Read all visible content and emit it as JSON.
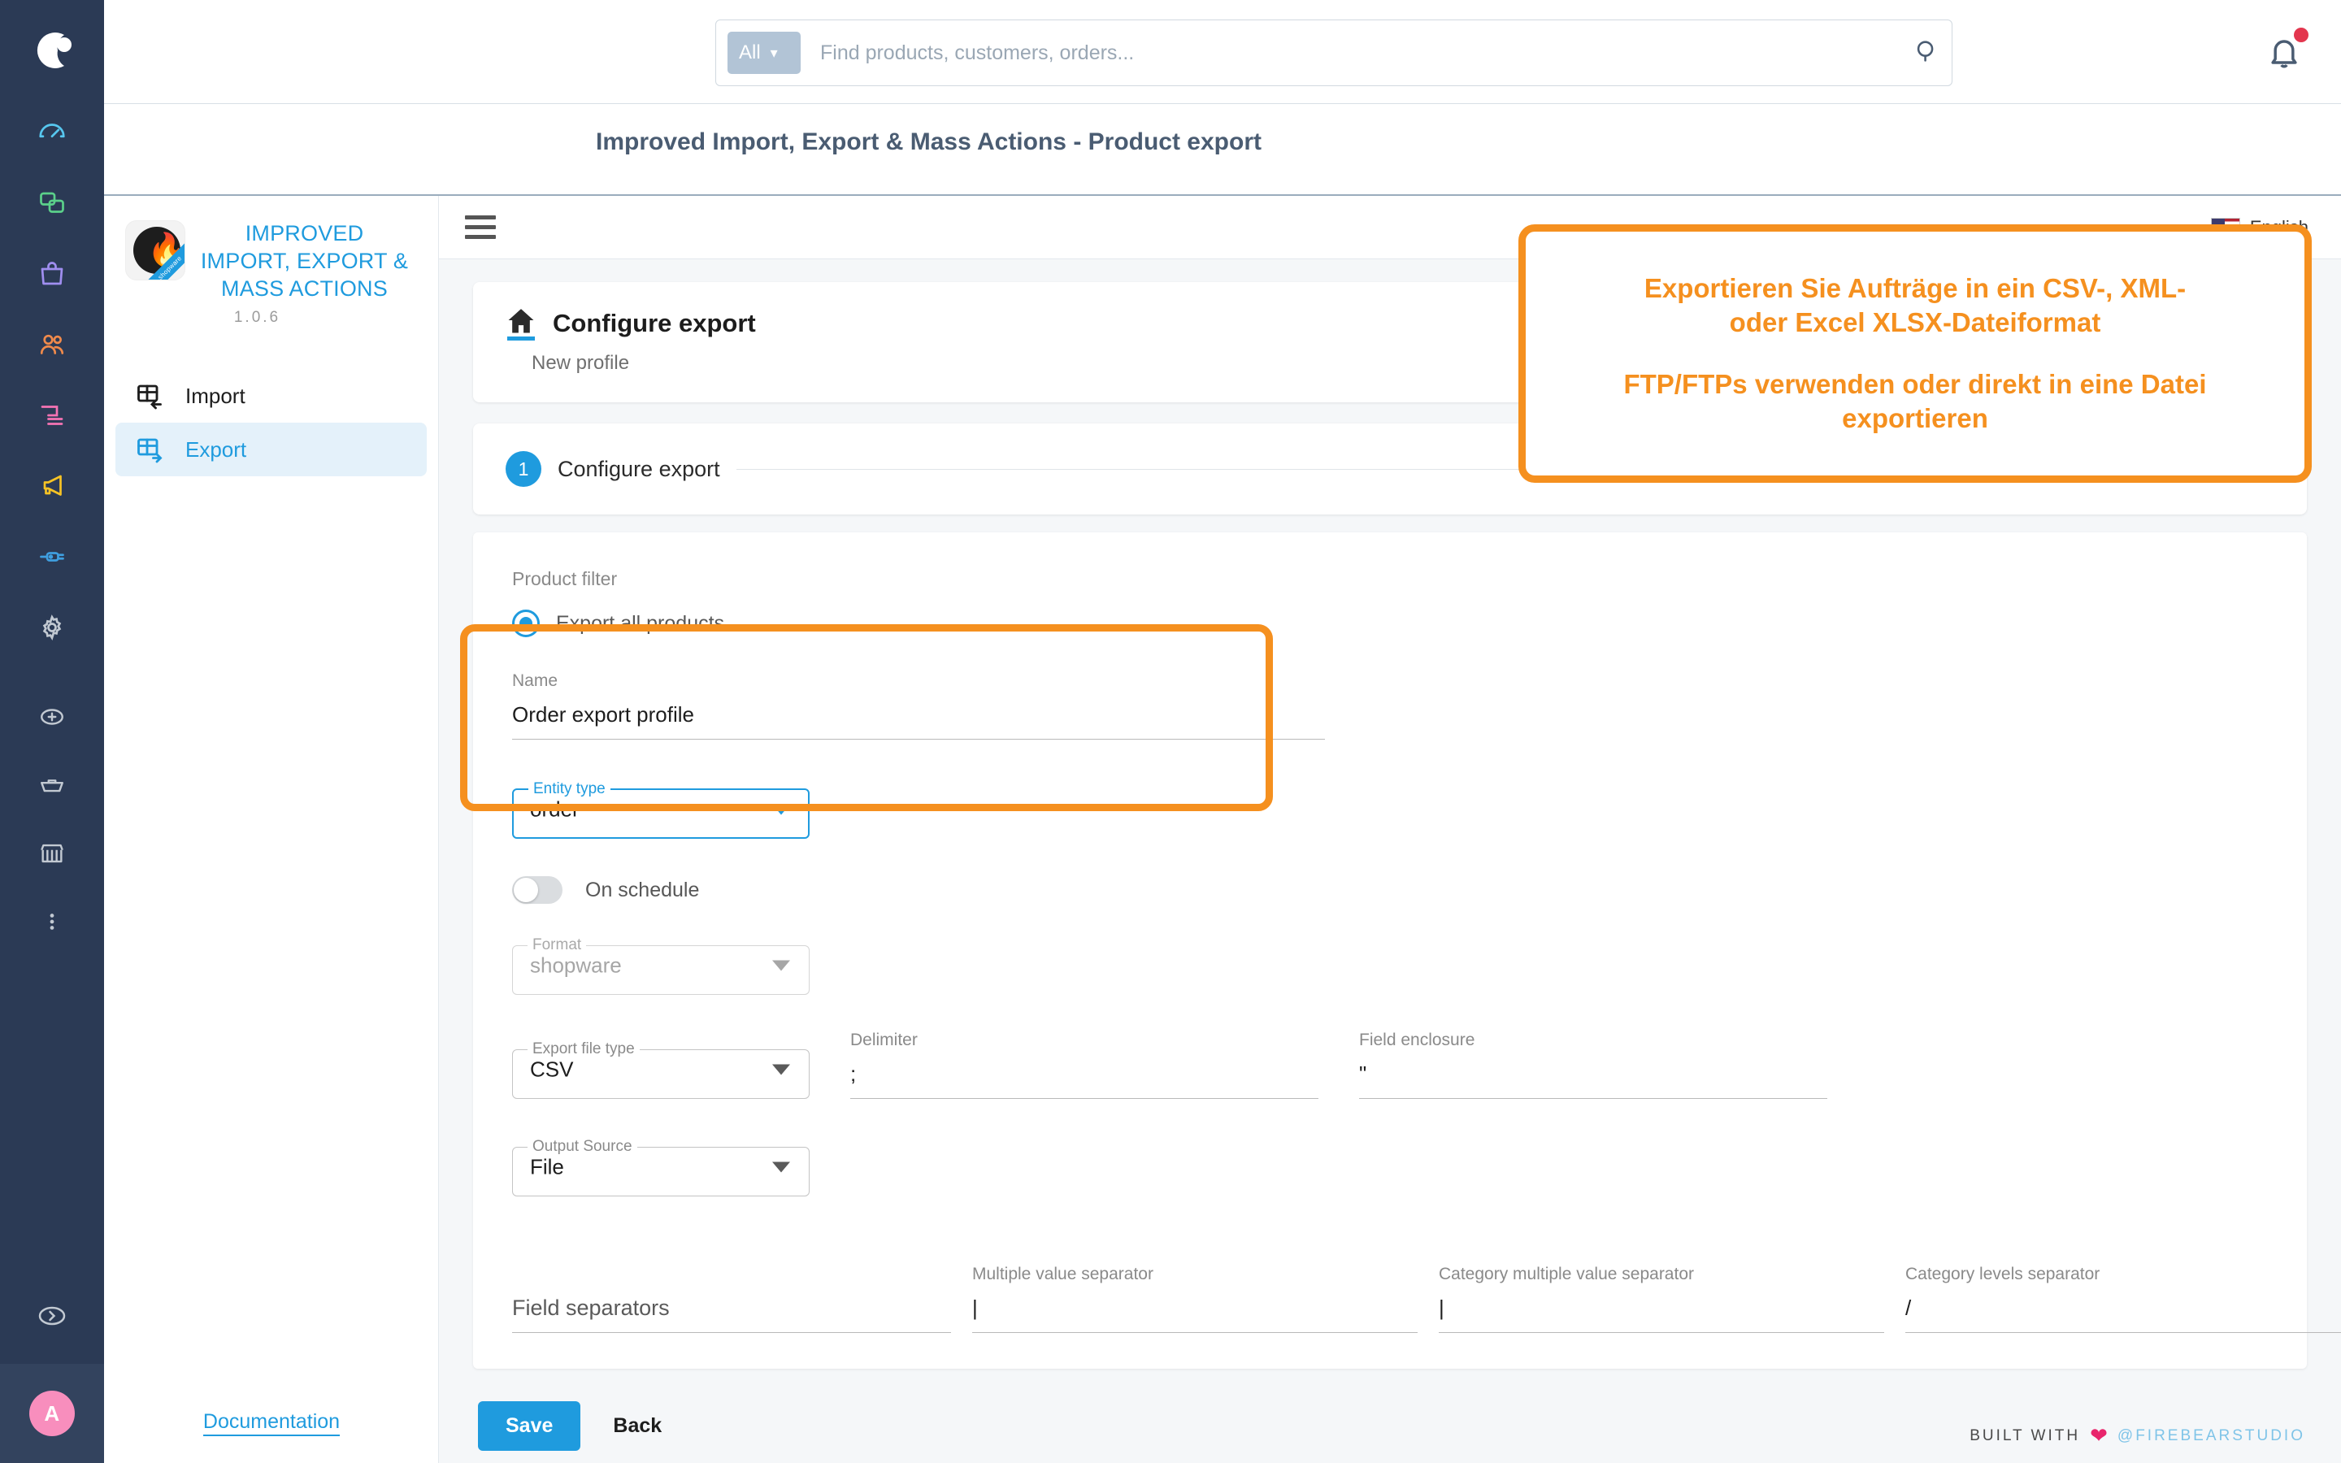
{
  "shopware_rail": {
    "logo_icon": "shopware-logo-icon",
    "items": [
      {
        "icon": "dashboard-icon",
        "color": "#57c7ef"
      },
      {
        "icon": "catalogue-icon",
        "color": "#5bd08a"
      },
      {
        "icon": "orders-bag-icon",
        "color": "#a08ef0"
      },
      {
        "icon": "customers-icon",
        "color": "#f08a4b"
      },
      {
        "icon": "content-icon",
        "color": "#f573b4"
      },
      {
        "icon": "marketing-megaphone-icon",
        "color": "#f7c325"
      },
      {
        "icon": "extensions-plug-icon",
        "color": "#3f9fe0"
      },
      {
        "icon": "settings-gear-icon",
        "color": "#c2c9d2"
      }
    ],
    "items2": [
      {
        "icon": "add-circle-icon",
        "color": "#c2c9d2"
      },
      {
        "icon": "basket-icon",
        "color": "#c2c9d2"
      },
      {
        "icon": "storefront-icon",
        "color": "#c2c9d2"
      },
      {
        "icon": "more-vertical-icon",
        "color": "#c2c9d2"
      }
    ],
    "expand_icon": "chevron-right-circle-icon",
    "avatar_initial": "A",
    "avatar_color": "#f88ebd"
  },
  "topbar": {
    "search": {
      "scope_label": "All",
      "scope_caret_icon": "chevron-down-icon",
      "placeholder": "Find products, customers, orders...",
      "search_icon": "search-icon"
    },
    "bell_icon": "notification-bell-icon",
    "bell_has_badge": true
  },
  "page": {
    "title": "Improved Import, Export & Mass Actions - Product export"
  },
  "app_sidebar": {
    "brand_title": "IMPROVED IMPORT, EXPORT & MASS ACTIONS",
    "brand_version": "1.0.6",
    "logo_icon": "firebear-flame-icon",
    "logo_ribbon": "shopware",
    "nav": [
      {
        "label": "Import",
        "icon": "import-table-icon",
        "active": false
      },
      {
        "label": "Export",
        "icon": "export-table-icon",
        "active": true
      }
    ],
    "documentation_link": "Documentation"
  },
  "content_topbar": {
    "menu_icon": "hamburger-menu-icon",
    "language": "English",
    "flag_icon": "us-flag-icon"
  },
  "card_header": {
    "home_icon": "home-icon",
    "title": "Configure export",
    "subtitle": "New profile"
  },
  "step": {
    "number": "1",
    "label": "Configure export"
  },
  "form": {
    "product_filter_label": "Product filter",
    "radio": {
      "label": "Export all products",
      "checked": true
    },
    "name": {
      "label": "Name",
      "value": "Order export profile"
    },
    "entity_type": {
      "label": "Entity type",
      "value": "order",
      "caret_icon": "chevron-down-icon",
      "focused": true
    },
    "on_schedule": {
      "label": "On schedule",
      "enabled": false
    },
    "format": {
      "label": "Format",
      "value": "shopware",
      "caret_icon": "chevron-down-icon",
      "disabled": true
    },
    "export_file_type": {
      "label": "Export file type",
      "value": "CSV",
      "caret_icon": "chevron-down-icon"
    },
    "delimiter": {
      "label": "Delimiter",
      "value": ";"
    },
    "field_enclosure": {
      "label": "Field enclosure",
      "value": "\""
    },
    "output_source": {
      "label": "Output Source",
      "value": "File",
      "caret_icon": "chevron-down-icon"
    },
    "field_separators": {
      "heading": "Field separators",
      "multiple_value_separator": {
        "label": "Multiple value separator",
        "value": "|"
      },
      "category_multiple_value_separator": {
        "label": "Category multiple value separator",
        "value": "|"
      },
      "category_levels_separator": {
        "label": "Category levels separator",
        "value": "/"
      }
    }
  },
  "actions": {
    "save_label": "Save",
    "back_label": "Back"
  },
  "footer": {
    "built_with": "BUILT WITH",
    "heart_icon": "heart-icon",
    "handle": "@FIREBEARSTUDIO"
  },
  "annotations": {
    "callout_line1": "Exportieren Sie Aufträge in ein CSV-, XML-",
    "callout_line2": "oder Excel XLSX-Dateiformat",
    "callout_line3": "FTP/FTPs verwenden oder direkt in eine Datei",
    "callout_line4": "exportieren",
    "accent_color": "#f5901f"
  }
}
